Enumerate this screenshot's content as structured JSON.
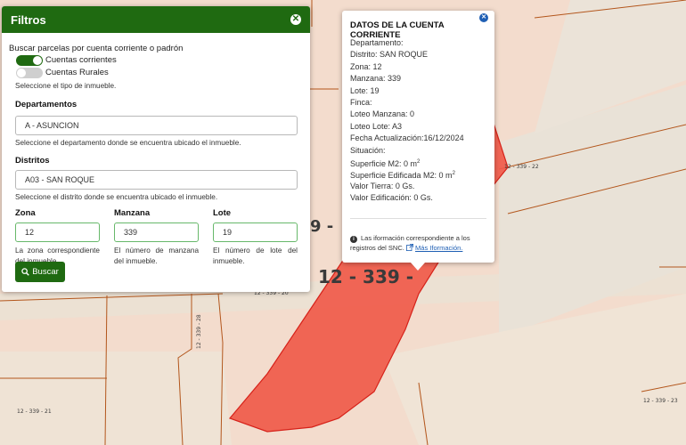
{
  "filter": {
    "title": "Filtros",
    "intro": "Buscar parcelas por cuenta corriente o padrón",
    "toggles": [
      {
        "label": "Cuentas corrientes",
        "on": true
      },
      {
        "label": "Cuentas Rurales",
        "on": false
      }
    ],
    "type_help": "Seleccione el tipo de inmueble.",
    "departamentos": {
      "label": "Departamentos",
      "value": "A - ASUNCION",
      "help": "Seleccione el departamento donde se encuentra ubicado el inmueble."
    },
    "distritos": {
      "label": "Distritos",
      "value": "A03 - SAN ROQUE",
      "help": "Seleccione el distrito donde se encuentra ubicado el inmueble."
    },
    "zona": {
      "label": "Zona",
      "value": "12",
      "help": "La zona correspondiente del inmueble."
    },
    "manzana": {
      "label": "Manzana",
      "value": "339",
      "help": "El número de manzana del inmueble."
    },
    "lote": {
      "label": "Lote",
      "value": "19",
      "help": "El número de lote del inmueble."
    },
    "search_button": "Buscar"
  },
  "popup": {
    "title": "DATOS DE LA CUENTA CORRIENTE",
    "fields": [
      "Departamento:",
      "Distrito: SAN ROQUE",
      "Zona: 12",
      "Manzana: 339",
      "Lote: 19",
      "Finca:",
      "Loteo Manzana: 0",
      "Loteo Lote: A3",
      "Fecha Actualización:16/12/2024",
      "Situación:"
    ],
    "superficie": "Superficie M2: 0 m",
    "superficie_edificada": "Superficie Edificada M2: 0 m",
    "sup_exponent": "2",
    "valor_tierra": "Valor Tierra: 0 Gs.",
    "valor_edificacion": "Valor Edificación: 0 Gs.",
    "note": "Las iformación correspondiente a los registros del SNC.",
    "link": "Más Iformación."
  },
  "map": {
    "parcel_label": "12 - 339 -",
    "partial_label": "9 -",
    "labels": [
      "12 - 339 - 22",
      "12 - 339 - 20",
      "12 - 339 - 28",
      "12 - 339 - 21",
      "12 - 339 - 23"
    ],
    "colors": {
      "parcel": "#f05a4a",
      "parcel_outline": "#d6221a",
      "background": "#f3dccd",
      "road": "#e8d9c6"
    }
  }
}
